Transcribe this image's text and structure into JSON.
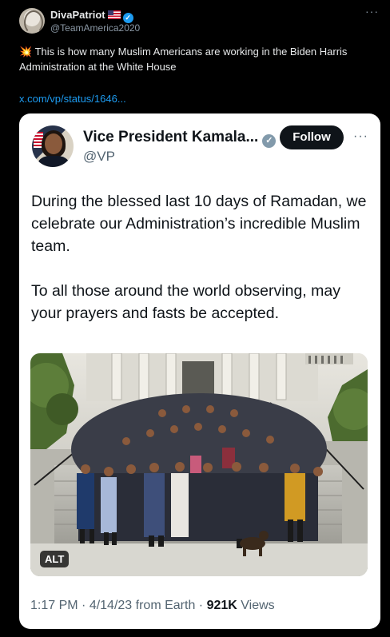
{
  "retweeter": {
    "name": "DivaPatriot",
    "handle": "@TeamAmerica2020",
    "flag_icon": "us-flag-icon",
    "verified_icon": "verified-badge-icon",
    "more_icon": "more-icon"
  },
  "tweet": {
    "emoji": "💥",
    "text": "This is how many Muslim Americans are working in the Biden Harris Administration at the White House",
    "link": "x.com/vp/status/1646..."
  },
  "quoted": {
    "name": "Vice President Kamala...",
    "handle": "@VP",
    "verified_icon": "gray-verified-badge-icon",
    "follow_label": "Follow",
    "paragraph1": "During the blessed last 10 days of Ramadan, we celebrate our Administration’s incredible Muslim team.",
    "paragraph2": "To all those around the world observing, may your prayers and fasts be accepted.",
    "photo_alt_label": "ALT",
    "time": "1:17 PM",
    "date": "4/14/23",
    "source": "from Earth",
    "views_count": "921K",
    "views_label": "Views"
  },
  "colors": {
    "background": "#000000",
    "card": "#ffffff",
    "link": "#1d9bf0",
    "follow_button": "#0f1419"
  }
}
